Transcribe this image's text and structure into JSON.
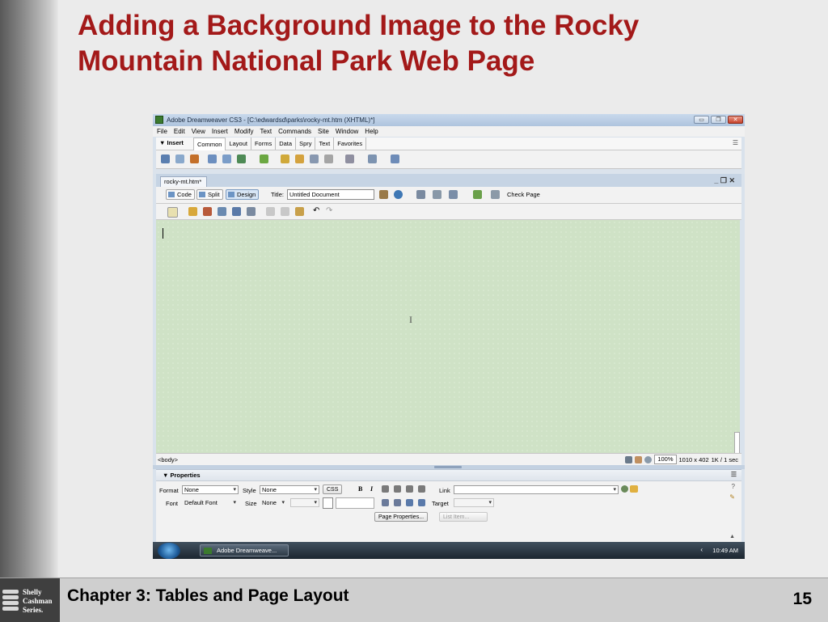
{
  "slide": {
    "title": "Adding a Background Image to the Rocky Mountain National Park Web Page",
    "footer_text": "Chapter 3: Tables and Page Layout",
    "page_number": "15",
    "logo_lines": [
      "Shelly",
      "Cashman",
      "Series."
    ],
    "accent_color": "#a31919"
  },
  "app": {
    "window_title": "Adobe Dreamweaver CS3 - [C:\\edwardsd\\parks\\rocky-mt.htm (XHTML)*]",
    "menu": [
      "File",
      "Edit",
      "View",
      "Insert",
      "Modify",
      "Text",
      "Commands",
      "Site",
      "Window",
      "Help"
    ],
    "insert_label": "▼ Insert",
    "insert_tabs": [
      "Common",
      "Layout",
      "Forms",
      "Data",
      "Spry",
      "Text",
      "Favorites"
    ],
    "insert_active_tab": "Common",
    "doc_tab": "rocky-mt.htm*",
    "view_buttons": [
      "Code",
      "Split",
      "Design"
    ],
    "active_view": "Design",
    "title_label": "Title:",
    "title_value": "Untitled Document",
    "check_page": "Check Page",
    "status": {
      "tag": "<body>",
      "zoom": "100%",
      "window_size": "1010 x 402",
      "download": "1K / 1 sec"
    },
    "properties": {
      "header": "▼ Properties",
      "format_label": "Format",
      "format_value": "None",
      "style_label": "Style",
      "style_value": "None",
      "css_button": "CSS",
      "bold": "B",
      "italic": "I",
      "link_label": "Link",
      "font_label": "Font",
      "font_value": "Default Font",
      "size_label": "Size",
      "size_value": "None",
      "target_label": "Target",
      "page_properties": "Page Properties...",
      "list_item": "List Item..."
    },
    "taskbar": {
      "task_label": "Adobe Dreamweave...",
      "clock": "10:49 AM"
    },
    "design_bg_color": "#cfe2c6"
  }
}
